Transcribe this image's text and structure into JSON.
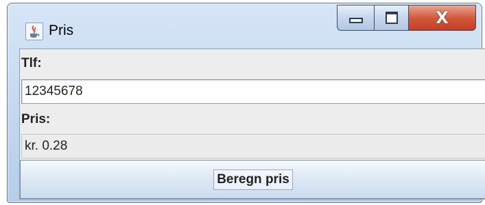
{
  "window": {
    "title": "Pris",
    "app_icon": "java-cup-icon",
    "controls": {
      "minimize": "minimize-icon",
      "maximize": "maximize-icon",
      "close": "close-icon",
      "close_glyph": "X"
    }
  },
  "form": {
    "phone_label": "Tlf:",
    "phone_value": "12345678",
    "price_label": "Pris:",
    "price_value": "kr. 0.28",
    "calc_button": "Beregn pris"
  },
  "colors": {
    "titlebar": "#c3d8ef",
    "close_button": "#d45a3d",
    "panel": "#ededed"
  }
}
